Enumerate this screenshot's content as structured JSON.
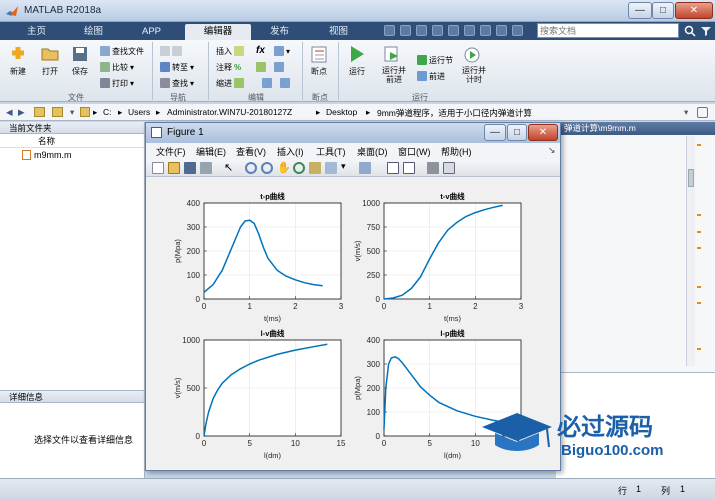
{
  "app": {
    "title": "MATLAB R2018a"
  },
  "tabs": [
    "主页",
    "绘图",
    "APP",
    "编辑器",
    "发布",
    "视图"
  ],
  "active_tab": "编辑器",
  "search": {
    "placeholder": "搜索文档"
  },
  "ribbon": {
    "file_group": {
      "new": "新建",
      "open": "打开",
      "save": "保存",
      "find_files": "查找文件",
      "compare": "比较",
      "print": "打印",
      "label": "文件"
    },
    "nav_group": {
      "goto": "转至",
      "find": "查找",
      "label": "导航"
    },
    "edit_group": {
      "insert": "插入",
      "fx": "fx",
      "comment": "注释",
      "indent": "缩进",
      "label": "编辑"
    },
    "breakpoint_group": {
      "breakpoints": "断点",
      "label": "断点"
    },
    "run_group": {
      "run": "运行",
      "run_advance": "运行并\n前进",
      "run_section": "运行节",
      "advance": "前进",
      "run_time": "运行并\n计时",
      "label": "运行"
    }
  },
  "address": {
    "drive": "C:",
    "parts": [
      "Users",
      "Administrator.WIN7U-20180127Z",
      "Desktop",
      "9mm弹道程序，适用于小口径内弹道计算"
    ]
  },
  "left_panel": {
    "title": "当前文件夹",
    "column": "名称",
    "files": [
      "m9mm.m"
    ],
    "details_title": "详细信息",
    "details_hint": "选择文件以查看详细信息"
  },
  "editor": {
    "tab_label": "弹道计算\\m9mm.m"
  },
  "status": {
    "row_label": "行",
    "row": "1",
    "col_label": "列",
    "col": "1"
  },
  "figure": {
    "title": "Figure 1",
    "menu": [
      "文件(F)",
      "编辑(E)",
      "查看(V)",
      "插入(I)",
      "工具(T)",
      "桌面(D)",
      "窗口(W)",
      "帮助(H)"
    ]
  },
  "colors": {
    "curve": "#0072bd",
    "tab_bar": "#2f4e77",
    "figure_bg": "#f0f0f0"
  },
  "chart_data": [
    {
      "type": "line",
      "title": "t-p曲线",
      "xlabel": "t(ms)",
      "ylabel": "p(Mpa)",
      "xlim": [
        0,
        3
      ],
      "ylim": [
        0,
        400
      ],
      "xticks": [
        0,
        1,
        2,
        3
      ],
      "yticks": [
        0,
        100,
        200,
        300,
        400
      ],
      "x": [
        0,
        0.2,
        0.4,
        0.6,
        0.8,
        0.9,
        1.0,
        1.1,
        1.2,
        1.3,
        1.4,
        1.6,
        1.8,
        2.0,
        2.2,
        2.4,
        2.6
      ],
      "y": [
        28,
        60,
        120,
        210,
        300,
        325,
        328,
        315,
        270,
        215,
        170,
        120,
        95,
        80,
        68,
        60,
        55
      ]
    },
    {
      "type": "line",
      "title": "t-v曲线",
      "xlabel": "t(ms)",
      "ylabel": "v(m/s)",
      "xlim": [
        0,
        3
      ],
      "ylim": [
        0,
        1000
      ],
      "xticks": [
        0,
        1,
        2,
        3
      ],
      "yticks": [
        0,
        250,
        500,
        750,
        1000
      ],
      "x": [
        0,
        0.2,
        0.4,
        0.6,
        0.8,
        1.0,
        1.2,
        1.4,
        1.6,
        1.8,
        2.0,
        2.2,
        2.4,
        2.6
      ],
      "y": [
        0,
        10,
        40,
        110,
        230,
        420,
        590,
        720,
        800,
        860,
        900,
        930,
        955,
        975
      ]
    },
    {
      "type": "line",
      "title": "l-v曲线",
      "xlabel": "l(dm)",
      "ylabel": "v(m/s)",
      "xlim": [
        0,
        15
      ],
      "ylim": [
        0,
        1000
      ],
      "xticks": [
        0,
        5,
        10,
        15
      ],
      "yticks": [
        0,
        500,
        1000
      ],
      "x": [
        0,
        0.2,
        0.5,
        1,
        1.5,
        2,
        3,
        4,
        5,
        6,
        8,
        10,
        12,
        13.5
      ],
      "y": [
        0,
        120,
        250,
        390,
        480,
        550,
        640,
        700,
        750,
        790,
        850,
        895,
        930,
        955
      ]
    },
    {
      "type": "line",
      "title": "l-p曲线",
      "xlabel": "l(dm)",
      "ylabel": "p(Mpa)",
      "xlim": [
        0,
        15
      ],
      "ylim": [
        0,
        400
      ],
      "xticks": [
        0,
        5,
        10,
        15
      ],
      "yticks": [
        0,
        100,
        200,
        300,
        400
      ],
      "x": [
        0,
        0.2,
        0.5,
        0.8,
        1.2,
        1.6,
        2,
        3,
        4,
        5,
        6,
        8,
        10,
        12,
        13.5
      ],
      "y": [
        30,
        200,
        300,
        325,
        330,
        322,
        305,
        255,
        205,
        170,
        140,
        105,
        82,
        65,
        55
      ]
    }
  ]
}
